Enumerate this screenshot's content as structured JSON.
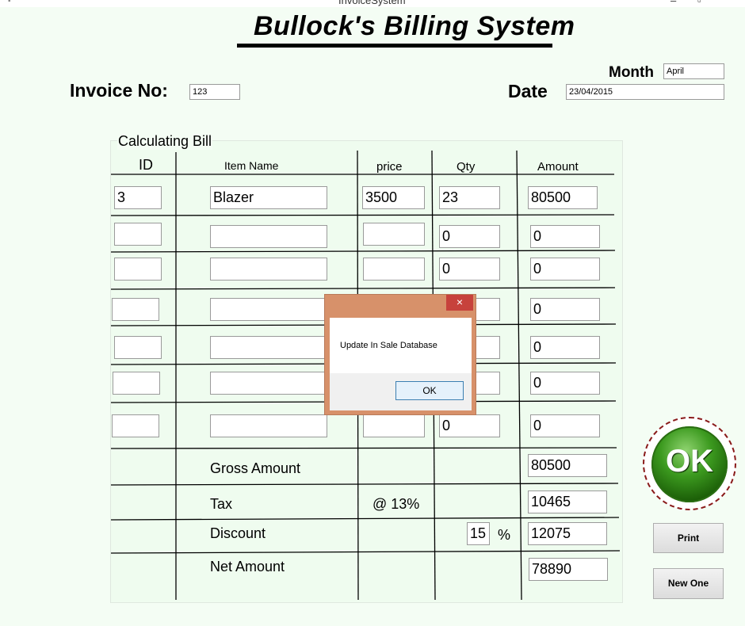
{
  "window": {
    "title": "InvoiceSystem",
    "minimize_label": "–",
    "maximize_label": "▫"
  },
  "header": {
    "app_title": "Bullock's Billing System",
    "invoice_label": "Invoice No:",
    "invoice_value": "123",
    "month_label": "Month",
    "month_value": "April",
    "date_label": "Date",
    "date_value": "23/04/2015"
  },
  "group": {
    "title": "Calculating Bill",
    "columns": [
      "ID",
      "Item Name",
      "price",
      "Qty",
      "Amount"
    ]
  },
  "items": [
    {
      "id": "3",
      "name": "Blazer",
      "price": "3500",
      "qty": "23",
      "amount": "80500"
    },
    {
      "id": "",
      "name": "",
      "price": "",
      "qty": "0",
      "amount": "0"
    },
    {
      "id": "",
      "name": "",
      "price": "",
      "qty": "0",
      "amount": "0"
    },
    {
      "id": "",
      "name": "",
      "price": "",
      "qty": "",
      "amount": "0"
    },
    {
      "id": "",
      "name": "",
      "price": "",
      "qty": "",
      "amount": "0"
    },
    {
      "id": "",
      "name": "",
      "price": "",
      "qty": "",
      "amount": "0"
    },
    {
      "id": "",
      "name": "",
      "price": "",
      "qty": "0",
      "amount": "0"
    }
  ],
  "totals": {
    "gross_label": "Gross Amount",
    "gross_value": "80500",
    "tax_label": "Tax",
    "tax_rate": "@ 13%",
    "tax_value": "10465",
    "discount_label": "Discount",
    "discount_pct": "15",
    "percent_sign": "%",
    "discount_value": "12075",
    "net_label": "Net Amount",
    "net_value": "78890"
  },
  "buttons": {
    "ok": "OK",
    "print": "Print",
    "new_one": "New One"
  },
  "dialog": {
    "message": "Update In Sale Database",
    "ok_label": "OK",
    "close_glyph": "×",
    "title_color": "#d7916a",
    "close_color": "#c7423c"
  },
  "colors": {
    "form_background": "#f4fdf4",
    "ok_button_green": "#3c9a1f"
  }
}
